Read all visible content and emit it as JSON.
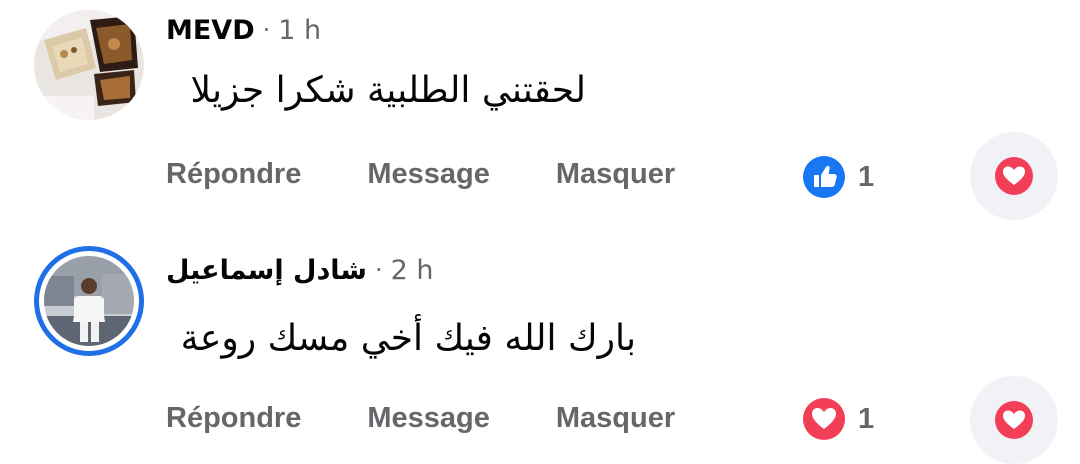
{
  "comments": [
    {
      "author": "MEVD",
      "separator": "·",
      "time": "1 h",
      "text": "لحقتني الطلبية شكرا جزيلا",
      "actions": {
        "reply": "Répondre",
        "message": "Message",
        "hide": "Masquer"
      },
      "reaction_icon": "like-icon",
      "reaction_count": "1",
      "avatar_icon": "food-photo-avatar"
    },
    {
      "author": "شادل إسماعيل",
      "separator": "·",
      "time": "2 h",
      "text": "بارك الله فيك أخي مسك روعة",
      "actions": {
        "reply": "Répondre",
        "message": "Message",
        "hide": "Masquer"
      },
      "reaction_icon": "love-icon",
      "reaction_count": "1",
      "avatar_icon": "player-photo-avatar"
    }
  ],
  "colors": {
    "like_blue": "#1877f2",
    "love_red": "#f33e58",
    "ring_blue": "#1f6fe6",
    "muted_text": "#65676b",
    "react_button_bg": "#f0f2f5"
  }
}
